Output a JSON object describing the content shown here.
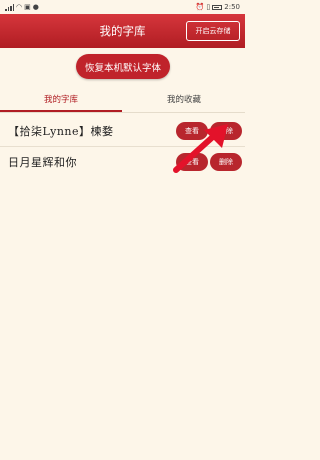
{
  "status_bar": {
    "left_icons": [
      "signal-icon",
      "wifi-icon",
      "image-icon",
      "notification-icon"
    ],
    "right_icons": [
      "alarm-icon",
      "vibrate-icon",
      "battery-icon"
    ],
    "time": "2:50"
  },
  "header": {
    "title": "我的字库",
    "cloud_button": "开启云存储"
  },
  "restore_button": "恢复本机默认字体",
  "tabs": [
    {
      "label": "我的字库",
      "active": true
    },
    {
      "label": "我的收藏",
      "active": false
    }
  ],
  "fonts": [
    {
      "name": "【拾柒Lynne】楝婺",
      "view_label": "查看",
      "delete_label": "删除"
    },
    {
      "name": "日月星辉和你",
      "view_label": "查看",
      "delete_label": "删除"
    }
  ],
  "colors": {
    "accent": "#b01d23",
    "background": "#fdf6e9",
    "arrow": "#e3122a"
  }
}
